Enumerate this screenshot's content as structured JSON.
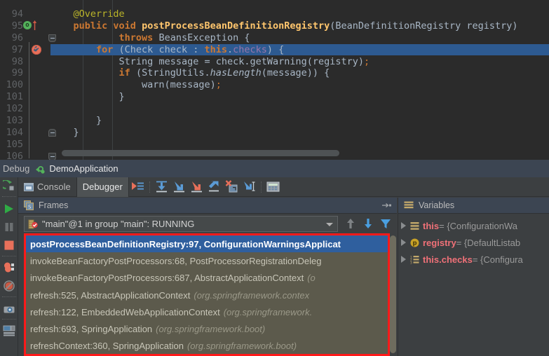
{
  "editor": {
    "first_line": 93,
    "highlighted_line": 97,
    "lines": [
      {
        "num": 94,
        "indent": 4,
        "tokens": [
          {
            "t": "@Override",
            "c": "ann"
          }
        ]
      },
      {
        "num": 95,
        "indent": 4,
        "tokens": [
          {
            "t": "public ",
            "c": "kw"
          },
          {
            "t": "void ",
            "c": "kw"
          },
          {
            "t": "postProcessBeanDefinitionRegistry",
            "c": "mth"
          },
          {
            "t": "(",
            "c": "p"
          },
          {
            "t": "BeanDefinitionRegistry registry",
            "c": "txt"
          },
          {
            "t": ")",
            "c": "p"
          }
        ],
        "gutter": "implements-override"
      },
      {
        "num": 96,
        "indent": 12,
        "tokens": [
          {
            "t": "throws ",
            "c": "kw"
          },
          {
            "t": "BeansException {",
            "c": "txt"
          }
        ],
        "gutter": "fold-open-top"
      },
      {
        "num": 97,
        "indent": 8,
        "tokens": [
          {
            "t": "for ",
            "c": "kw"
          },
          {
            "t": "(Check check : ",
            "c": "txt"
          },
          {
            "t": "this",
            "c": "kw"
          },
          {
            "t": ".",
            "c": "txt"
          },
          {
            "t": "checks",
            "c": "fld"
          },
          {
            "t": ") {",
            "c": "txt"
          }
        ],
        "gutter": "breakpoint-verified",
        "highlight": true
      },
      {
        "num": 98,
        "indent": 12,
        "tokens": [
          {
            "t": "String message = check.getWarning(registry)",
            "c": "txt"
          },
          {
            "t": ";",
            "c": "sem"
          }
        ]
      },
      {
        "num": 99,
        "indent": 12,
        "tokens": [
          {
            "t": "if ",
            "c": "kw"
          },
          {
            "t": "(StringUtils.",
            "c": "txt"
          },
          {
            "t": "hasLength",
            "c": "ital"
          },
          {
            "t": "(message)) {",
            "c": "txt"
          }
        ]
      },
      {
        "num": 100,
        "indent": 16,
        "tokens": [
          {
            "t": "warn(message)",
            "c": "txt"
          },
          {
            "t": ";",
            "c": "sem"
          }
        ]
      },
      {
        "num": 101,
        "indent": 12,
        "tokens": [
          {
            "t": "}",
            "c": "txt"
          }
        ]
      },
      {
        "num": 102,
        "indent": 0,
        "tokens": []
      },
      {
        "num": 103,
        "indent": 8,
        "tokens": [
          {
            "t": "}",
            "c": "txt"
          }
        ]
      },
      {
        "num": 104,
        "indent": 4,
        "tokens": [
          {
            "t": "}",
            "c": "txt"
          }
        ],
        "gutter": "fold-open-bottom"
      },
      {
        "num": 105,
        "indent": 0,
        "tokens": []
      },
      {
        "num": 106,
        "indent": 0,
        "tokens": [],
        "gutter": "fold-collapsed"
      }
    ]
  },
  "debug_header": {
    "label": "Debug",
    "config_icon": "bug-run-icon",
    "title": "DemoApplication"
  },
  "left_strip": [
    {
      "name": "rerun-icon",
      "label": "Rerun"
    },
    {
      "name": "resume-program-icon",
      "label": "Resume Program"
    },
    {
      "name": "pause-program-icon",
      "label": "Pause Program"
    },
    {
      "name": "stop-icon",
      "label": "Stop"
    },
    {
      "name": "view-breakpoints-icon",
      "label": "View Breakpoints"
    },
    {
      "name": "mute-breakpoints-icon",
      "label": "Mute Breakpoints"
    },
    {
      "name": "settings-icon",
      "label": "Settings"
    },
    {
      "name": "layout-icon",
      "label": "Restore Layout"
    }
  ],
  "tabs": [
    {
      "label": "Console",
      "icon": "console-icon",
      "active": false
    },
    {
      "label": "Debugger",
      "icon": "",
      "active": true
    }
  ],
  "toolbar_buttons": [
    {
      "name": "show-execution-point-icon",
      "label": "Show Execution Point"
    },
    {
      "name": "step-over-icon",
      "label": "Step Over"
    },
    {
      "name": "step-into-icon",
      "label": "Step Into"
    },
    {
      "name": "force-step-into-icon",
      "label": "Force Step Into"
    },
    {
      "name": "step-out-icon",
      "label": "Step Out"
    },
    {
      "name": "drop-frame-icon",
      "label": "Drop Frame"
    },
    {
      "name": "run-to-cursor-icon",
      "label": "Run to Cursor"
    },
    {
      "name": "evaluate-expression-icon",
      "label": "Evaluate Expression"
    }
  ],
  "frames": {
    "title": "Frames",
    "title_icon": "frames-icon",
    "minimize_icon": "minimize-icon",
    "thread": {
      "icon": "thread-suspended-icon",
      "text": "\"main\"@1 in group \"main\": RUNNING",
      "dropdown_icon": "chevron-down-icon"
    },
    "thread_controls": [
      {
        "name": "frames-up-icon",
        "label": "Up"
      },
      {
        "name": "frames-down-icon",
        "label": "Down"
      },
      {
        "name": "filter-frames-icon",
        "label": "Filter"
      }
    ],
    "highlight_color": "#ff1a1a",
    "selected_index": 0,
    "items": [
      {
        "method": "postProcessBeanDefinitionRegistry:97, ConfigurationWarningsApplicat",
        "pkg": ""
      },
      {
        "method": "invokeBeanFactoryPostProcessors:68, PostProcessorRegistrationDeleg",
        "pkg": ""
      },
      {
        "method": "invokeBeanFactoryPostProcessors:687, AbstractApplicationContext",
        "pkg": "(o"
      },
      {
        "method": "refresh:525, AbstractApplicationContext",
        "pkg": "(org.springframework.contex"
      },
      {
        "method": "refresh:122, EmbeddedWebApplicationContext",
        "pkg": "(org.springframework."
      },
      {
        "method": "refresh:693, SpringApplication",
        "pkg": "(org.springframework.boot)"
      },
      {
        "method": "refreshContext:360, SpringApplication",
        "pkg": "(org.springframework.boot)"
      }
    ]
  },
  "variables": {
    "title": "Variables",
    "title_icon": "variables-icon",
    "items": [
      {
        "icon": "object-field-icon",
        "name": "this",
        "value": "= {ConfigurationWa"
      },
      {
        "icon": "parameter-icon",
        "name": "registry",
        "value": "= {DefaultListab"
      },
      {
        "icon": "array-icon",
        "name": "this.checks",
        "value": "= {Configura"
      }
    ]
  },
  "colors": {
    "editor_bg": "#2b2b2b",
    "panel_bg": "#3c3f41",
    "panel_header_bg": "#3c4552",
    "exec_line_bg": "#2d5a91",
    "frames_bg": "#5c5a4c",
    "frame_selected_bg": "#2f5f9e",
    "annotation_red": "#ff1a1a",
    "var_name": "#f07178"
  }
}
